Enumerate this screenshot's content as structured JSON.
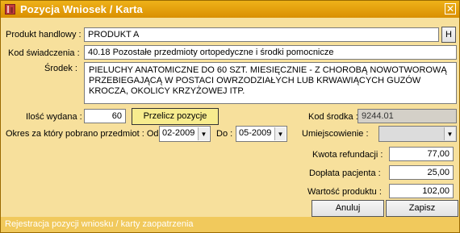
{
  "window": {
    "title": "Pozycja Wniosek / Karta",
    "close": "✕"
  },
  "form": {
    "produkt_label": "Produkt handlowy :",
    "produkt_value": "PRODUKT A",
    "h_button": "H",
    "kod_label": "Kod świadczenia :",
    "kod_value": "40.18 Pozostałe przedmioty ortopedyczne i środki pomocnicze",
    "srodek_label": "Środek :",
    "srodek_value": "PIELUCHY ANATOMICZNE DO 60 SZT. MIESIĘCZNIE - Z CHOROBĄ NOWOTWOROWĄ PRZEBIEGAJĄCĄ W POSTACI OWRZODZIAŁYCH LUB KRWAWIĄCYCH GUZÓW KROCZA, OKOLICY KRZYŻOWEJ ITP.",
    "ilosc_label": "Ilość wydana :",
    "ilosc_value": "60",
    "przelicz_button": "Przelicz pozycje",
    "kod_srodka_label": "Kod środka :",
    "kod_srodka_value": "9244.01",
    "okres_label": "Okres za który pobrano przedmiot : Od :",
    "od_value": "02-2009",
    "do_label": "Do :",
    "do_value": "05-2009",
    "umiejscowienie_label": "Umiejscowienie :",
    "umiejscowienie_value": "",
    "kwota_label": "Kwota refundacji :",
    "kwota_value": "77,00",
    "doplata_label": "Dopłata pacjenta :",
    "doplata_value": "25,00",
    "wartosc_label": "Wartość produktu :",
    "wartosc_value": "102,00",
    "anuluj_button": "Anuluj",
    "zapisz_button": "Zapisz"
  },
  "status": {
    "text": "Rejestracja pozycji wniosku / karty zaopatrzenia"
  },
  "colors": {
    "title_bg": "#e09a00",
    "client_bg": "#f7e09c",
    "status_bg": "#f1c95c"
  }
}
